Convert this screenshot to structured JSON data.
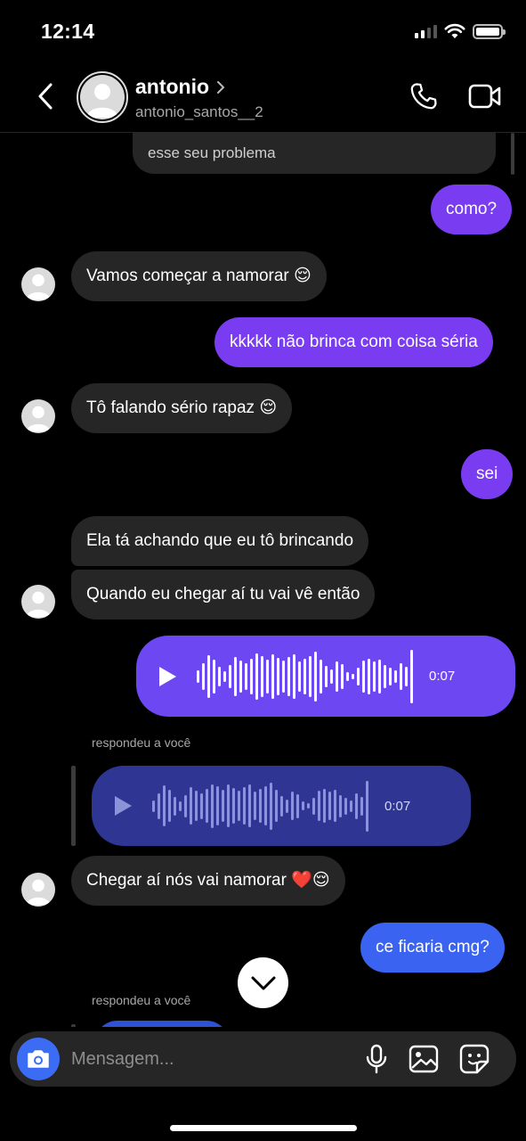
{
  "status_bar": {
    "time": "12:14",
    "signal_icon": "cellular-signal-icon",
    "wifi_icon": "wifi-icon",
    "battery_icon": "battery-icon"
  },
  "header": {
    "back_icon": "chevron-left-icon",
    "name": "antonio",
    "name_chevron": "chevron-right-icon",
    "username": "antonio_santos__2",
    "call_icon": "phone-icon",
    "video_icon": "video-camera-icon"
  },
  "messages": [
    {
      "side": "in",
      "text": "esse seu problema",
      "partial": true
    },
    {
      "side": "out",
      "text": "como?"
    },
    {
      "side": "in",
      "text": "Vamos começar a namorar 😌"
    },
    {
      "side": "out",
      "text": "kkkkk não brinca com coisa séria"
    },
    {
      "side": "in",
      "text": "Tô falando sério rapaz 😌"
    },
    {
      "side": "out",
      "text": "sei"
    },
    {
      "side": "in",
      "text": "Ela tá achando que eu tô brincando"
    },
    {
      "side": "in",
      "text": "Quando eu chegar aí tu vai vê então"
    },
    {
      "side": "out",
      "type": "voice",
      "duration": "0:07"
    },
    {
      "side": "in",
      "type": "reply_label",
      "text": "respondeu a você"
    },
    {
      "side": "in",
      "type": "voice_quote",
      "duration": "0:07"
    },
    {
      "side": "in",
      "text": "Chegar aí nós vai namorar ❤️😌"
    },
    {
      "side": "out",
      "text": "ce ficaria cmg?"
    },
    {
      "side": "in",
      "type": "reply_label",
      "text": "respondeu a você"
    }
  ],
  "scroll_down_icon": "chevron-down-icon",
  "composer": {
    "camera_icon": "camera-icon",
    "placeholder": "Mensagem...",
    "mic_icon": "microphone-icon",
    "gallery_icon": "image-gallery-icon",
    "sticker_icon": "sticker-icon"
  },
  "colors": {
    "background": "#000000",
    "incoming_bubble": "#262626",
    "outgoing_bubble": "#7a3cf1",
    "outgoing_bubble_blue": "#3a63f1",
    "voice_sent": "#6d47f2",
    "voice_reply": "#2f3592",
    "camera_button": "#3d6cf4"
  }
}
